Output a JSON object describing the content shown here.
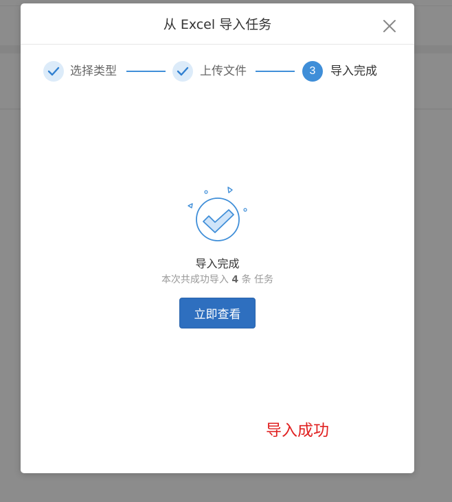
{
  "modal": {
    "title": "从 Excel 导入任务"
  },
  "steps": [
    {
      "label": "选择类型",
      "state": "done"
    },
    {
      "label": "上传文件",
      "state": "done"
    },
    {
      "label": "导入完成",
      "state": "active",
      "number": "3"
    }
  ],
  "result": {
    "title": "导入完成",
    "desc_prefix": "本次共成功导入",
    "count": "4",
    "desc_suffix": "条 任务",
    "view_button_label": "立即查看"
  },
  "annotation": {
    "text": "导入成功",
    "color": "#e02020"
  },
  "colors": {
    "accent": "#3f8ed8",
    "button": "#2e6fbf",
    "step_done_bg": "#dcebf9"
  },
  "icons": {
    "close": "close-icon",
    "step_done": "check-icon",
    "success": "success-check-icon"
  }
}
